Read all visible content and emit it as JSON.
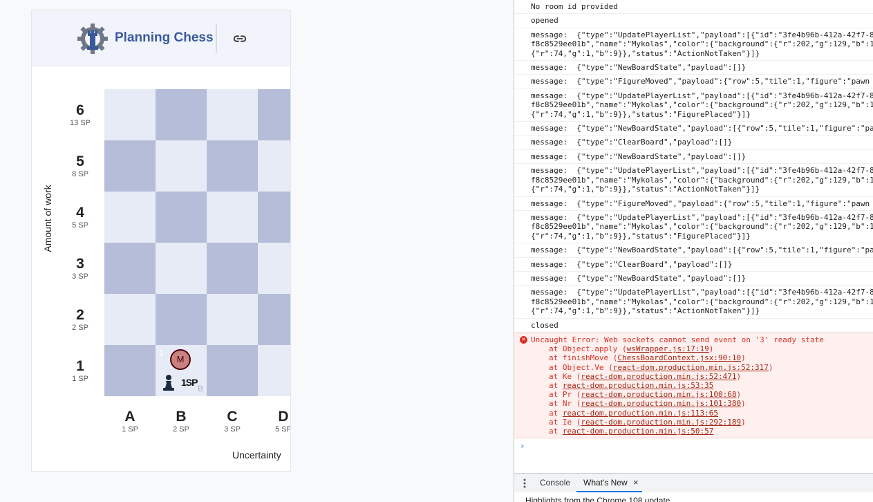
{
  "app": {
    "title": "Planning Chess",
    "y_axis_label": "Amount of work",
    "x_axis_label": "Uncertainty",
    "rows": [
      {
        "rank": "6",
        "sp": "13 SP"
      },
      {
        "rank": "5",
        "sp": "8 SP"
      },
      {
        "rank": "4",
        "sp": "5 SP"
      },
      {
        "rank": "3",
        "sp": "3 SP"
      },
      {
        "rank": "2",
        "sp": "2 SP"
      },
      {
        "rank": "1",
        "sp": "1 SP"
      }
    ],
    "columns": [
      {
        "file": "A",
        "sp": "1 SP"
      },
      {
        "file": "B",
        "sp": "2 SP"
      },
      {
        "file": "C",
        "sp": "3 SP"
      },
      {
        "file": "D",
        "sp": "5 SP"
      }
    ],
    "placed": {
      "player_initial": "M",
      "corner_number": "1",
      "cell_letter": "B",
      "pawn_label": "1SP"
    }
  },
  "devtools": {
    "log": [
      "No room id provided",
      "opened",
      "message:  {\"type\":\"UpdatePlayerList\",\"payload\":[{\"id\":\"3fe4b96b-412a-42f7-8\nf8c8529ee01b\",\"name\":\"Mykolas\",\"color\":{\"background\":{\"r\":202,\"g\":129,\"b\":1\n{\"r\":74,\"g\":1,\"b\":9}},\"status\":\"ActionNotTaken\"}]}",
      "message:  {\"type\":\"NewBoardState\",\"payload\":[]}",
      "message:  {\"type\":\"FigureMoved\",\"payload\":{\"row\":5,\"tile\":1,\"figure\":\"pawn",
      "message:  {\"type\":\"UpdatePlayerList\",\"payload\":[{\"id\":\"3fe4b96b-412a-42f7-8\nf8c8529ee01b\",\"name\":\"Mykolas\",\"color\":{\"background\":{\"r\":202,\"g\":129,\"b\":1\n{\"r\":74,\"g\":1,\"b\":9}},\"status\":\"FigurePlaced\"}]}",
      "message:  {\"type\":\"NewBoardState\",\"payload\":[{\"row\":5,\"tile\":1,\"figure\":\"pa",
      "message:  {\"type\":\"ClearBoard\",\"payload\":[]}",
      "message:  {\"type\":\"NewBoardState\",\"payload\":[]}",
      "message:  {\"type\":\"UpdatePlayerList\",\"payload\":[{\"id\":\"3fe4b96b-412a-42f7-8\nf8c8529ee01b\",\"name\":\"Mykolas\",\"color\":{\"background\":{\"r\":202,\"g\":129,\"b\":1\n{\"r\":74,\"g\":1,\"b\":9}},\"status\":\"ActionNotTaken\"}]}",
      "message:  {\"type\":\"FigureMoved\",\"payload\":{\"row\":5,\"tile\":1,\"figure\":\"pawn",
      "message:  {\"type\":\"UpdatePlayerList\",\"payload\":[{\"id\":\"3fe4b96b-412a-42f7-8\nf8c8529ee01b\",\"name\":\"Mykolas\",\"color\":{\"background\":{\"r\":202,\"g\":129,\"b\":1\n{\"r\":74,\"g\":1,\"b\":9}},\"status\":\"FigurePlaced\"}]}",
      "message:  {\"type\":\"NewBoardState\",\"payload\":[{\"row\":5,\"tile\":1,\"figure\":\"pa",
      "message:  {\"type\":\"ClearBoard\",\"payload\":[]}",
      "message:  {\"type\":\"NewBoardState\",\"payload\":[]}",
      "message:  {\"type\":\"UpdatePlayerList\",\"payload\":[{\"id\":\"3fe4b96b-412a-42f7-8\nf8c8529ee01b\",\"name\":\"Mykolas\",\"color\":{\"background\":{\"r\":202,\"g\":129,\"b\":1\n{\"r\":74,\"g\":1,\"b\":9}},\"status\":\"ActionNotTaken\"}]}",
      "closed"
    ],
    "error": {
      "message": "Uncaught Error: Web sockets cannot send event on '3' ready state",
      "stack": [
        {
          "fn": "at Object.apply (",
          "loc": "wsWrapper.js:17:19",
          "end": ")"
        },
        {
          "fn": "at finishMove (",
          "loc": "ChessBoardContext.jsx:90:10",
          "end": ")"
        },
        {
          "fn": "at Object.Ve (",
          "loc": "react-dom.production.min.js:52:317",
          "end": ")"
        },
        {
          "fn": "at Ke (",
          "loc": "react-dom.production.min.js:52:471",
          "end": ")"
        },
        {
          "fn": "at ",
          "loc": "react-dom.production.min.js:53:35",
          "end": ""
        },
        {
          "fn": "at Pr (",
          "loc": "react-dom.production.min.js:100:68",
          "end": ")"
        },
        {
          "fn": "at Nr (",
          "loc": "react-dom.production.min.js:101:380",
          "end": ")"
        },
        {
          "fn": "at ",
          "loc": "react-dom.production.min.js:113:65",
          "end": ""
        },
        {
          "fn": "at Ie (",
          "loc": "react-dom.production.min.js:292:189",
          "end": ")"
        },
        {
          "fn": "at ",
          "loc": "react-dom.production.min.js:50:57",
          "end": ""
        }
      ]
    },
    "prompt": "›",
    "drawer": {
      "tab_console": "Console",
      "tab_whats_new": "What's New",
      "close": "×",
      "content": "Highlights from the Chrome 108 update"
    }
  }
}
